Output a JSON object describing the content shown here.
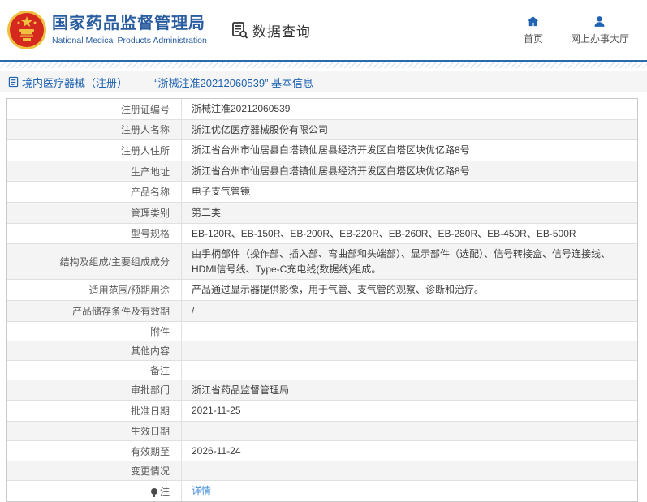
{
  "header": {
    "org_title_zh": "国家药品监督管理局",
    "org_title_en": "National Medical Products Administration",
    "section_title": "数据查询",
    "nav": [
      {
        "icon": "home-icon",
        "label": "首页"
      },
      {
        "icon": "user-icon",
        "label": "网上办事大厅"
      }
    ]
  },
  "breadcrumb": {
    "text": "境内医疗器械（注册） —— “浙械注准20212060539” 基本信息"
  },
  "detail_table": {
    "rows": [
      {
        "label": "注册证编号",
        "value": "浙械注准20212060539"
      },
      {
        "label": "注册人名称",
        "value": "浙江优亿医疗器械股份有限公司"
      },
      {
        "label": "注册人住所",
        "value": "浙江省台州市仙居县白塔镇仙居县经济开发区白塔区块优亿路8号"
      },
      {
        "label": "生产地址",
        "value": "浙江省台州市仙居县白塔镇仙居县经济开发区白塔区块优亿路8号"
      },
      {
        "label": "产品名称",
        "value": "电子支气管镜"
      },
      {
        "label": "管理类别",
        "value": "第二类"
      },
      {
        "label": "型号规格",
        "value": "EB-120R、EB-150R、EB-200R、EB-220R、EB-260R、EB-280R、EB-450R、EB-500R"
      },
      {
        "label": "结构及组成/主要组成成分",
        "value": "由手柄部件（操作部、插入部、弯曲部和头端部）、显示部件（选配）、信号转接盒、信号连接线、HDMI信号线、Type-C充电线(数据线)组成。"
      },
      {
        "label": "适用范围/预期用途",
        "value": "产品通过显示器提供影像，用于气管、支气管的观察、诊断和治疗。"
      },
      {
        "label": "产品储存条件及有效期",
        "value": "/"
      },
      {
        "label": "附件",
        "value": ""
      },
      {
        "label": "其他内容",
        "value": ""
      },
      {
        "label": "备注",
        "value": ""
      },
      {
        "label": "审批部门",
        "value": "浙江省药品监督管理局"
      },
      {
        "label": "批准日期",
        "value": "2021-11-25"
      },
      {
        "label": "生效日期",
        "value": ""
      },
      {
        "label": "有效期至",
        "value": "2026-11-24"
      },
      {
        "label": "变更情况",
        "value": ""
      },
      {
        "label": "注",
        "label_icon": "bulb-icon",
        "value": "详情",
        "value_is_link": true
      }
    ]
  },
  "colors": {
    "brand_blue": "#2a5d9f",
    "icon_blue": "#2063b2",
    "link_blue": "#4a90d9",
    "divider_blue": "#2a6bb0",
    "emblem_red": "#d5281e",
    "emblem_gold": "#f0c040",
    "row_alt_bg": "#f4f4f4"
  }
}
